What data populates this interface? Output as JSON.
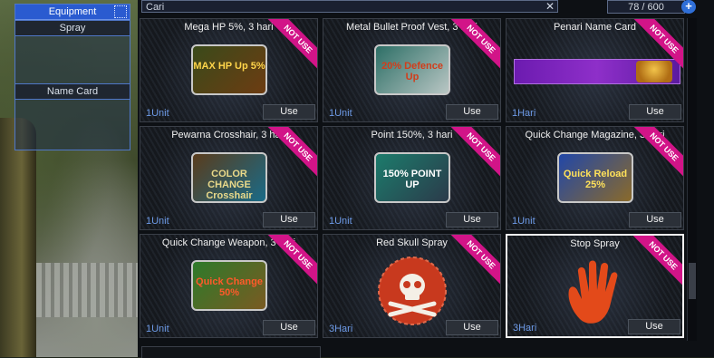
{
  "equipment": {
    "title": "Equipment",
    "slots": [
      {
        "label": "Spray"
      },
      {
        "label": "Name Card"
      }
    ]
  },
  "search": {
    "placeholder": "Cari",
    "value": "Cari"
  },
  "inventory_count": "78 / 600",
  "add_button": "+",
  "colors": {
    "ribbon": "#d21488",
    "qty": "#6e9be8",
    "panel_header": "#2a5bd0"
  },
  "items": [
    {
      "name": "Mega HP 5%, 3 hari",
      "quantity": "1Unit",
      "button": "Use",
      "badge": "NOT USE",
      "icon": "max-hp-up-icon",
      "icon_caption": "MAX HP Up 5%"
    },
    {
      "name": "Metal Bullet Proof Vest, 3 hari",
      "quantity": "1Unit",
      "button": "Use",
      "badge": "NOT USE",
      "icon": "defence-up-icon",
      "icon_caption": "20% Defence Up"
    },
    {
      "name": "Penari Name Card",
      "quantity": "1Hari",
      "button": "Use",
      "badge": "NOT USE",
      "icon": "name-card-banner-icon",
      "icon_caption": ""
    },
    {
      "name": "Pewarna Crosshair, 3 hari",
      "quantity": "1Unit",
      "button": "Use",
      "badge": "NOT USE",
      "icon": "color-change-crosshair-icon",
      "icon_caption": "COLOR CHANGE Crosshair"
    },
    {
      "name": "Point 150%, 3 hari",
      "quantity": "1Unit",
      "button": "Use",
      "badge": "NOT USE",
      "icon": "point-up-icon",
      "icon_caption": "150% POINT UP"
    },
    {
      "name": "Quick Change Magazine, 3 hari",
      "quantity": "1Unit",
      "button": "Use",
      "badge": "NOT USE",
      "icon": "quick-reload-icon",
      "icon_caption": "Quick Reload 25%"
    },
    {
      "name": "Quick Change Weapon, 3 hari",
      "quantity": "1Unit",
      "button": "Use",
      "badge": "NOT USE",
      "icon": "quick-change-icon",
      "icon_caption": "Quick Change 50%"
    },
    {
      "name": "Red Skull Spray",
      "quantity": "3Hari",
      "button": "Use",
      "badge": "NOT USE",
      "icon": "red-skull-spray-icon",
      "icon_caption": ""
    },
    {
      "name": "Stop Spray",
      "quantity": "3Hari",
      "button": "Use",
      "badge": "NOT USE",
      "icon": "stop-hand-spray-icon",
      "icon_caption": "",
      "selected": true
    }
  ]
}
